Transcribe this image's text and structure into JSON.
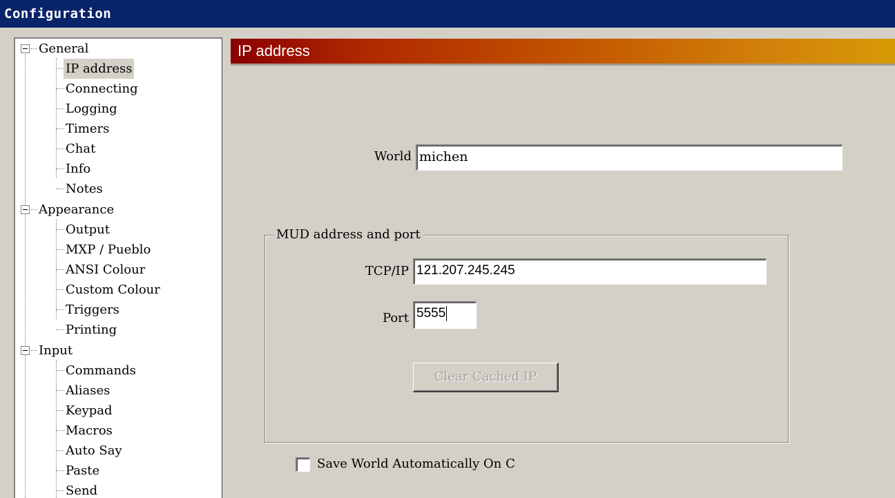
{
  "window": {
    "title": "Configuration"
  },
  "tree": {
    "groups": [
      {
        "label": "General",
        "children": [
          "IP address",
          "Connecting",
          "Logging",
          "Timers",
          "Chat",
          "Info",
          "Notes"
        ]
      },
      {
        "label": "Appearance",
        "children": [
          "Output",
          "MXP / Pueblo",
          "ANSI Colour",
          "Custom Colour",
          "Triggers",
          "Printing"
        ]
      },
      {
        "label": "Input",
        "children": [
          "Commands",
          "Aliases",
          "Keypad",
          "Macros",
          "Auto Say",
          "Paste",
          "Send"
        ]
      }
    ],
    "selected": "IP address"
  },
  "panel": {
    "banner_title": "IP address",
    "world_label": "World",
    "world_value": "michen",
    "group_title": "MUD address and port",
    "tcpip_label": "TCP/IP",
    "tcpip_value": "121.207.245.245",
    "port_label": "Port",
    "port_value": "5555",
    "clear_button": "Clear Cached IP",
    "checkbox_label": "Save World Automatically On C",
    "checkbox_checked": false
  }
}
